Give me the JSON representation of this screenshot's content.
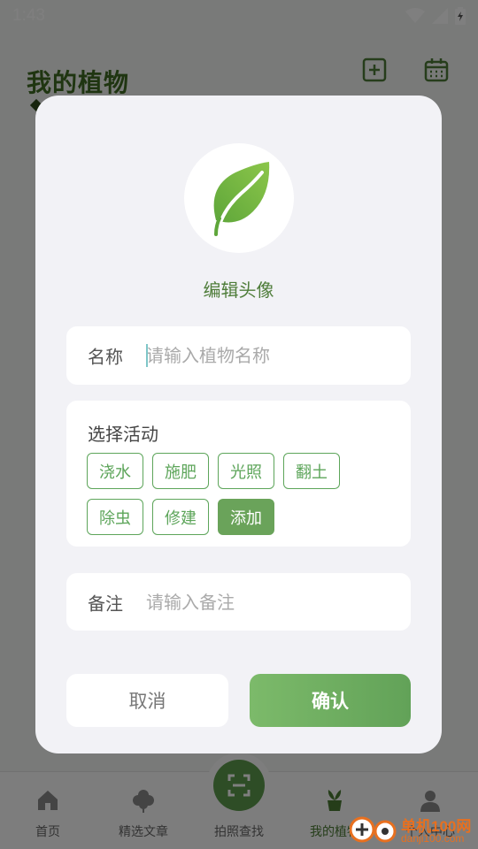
{
  "status_bar": {
    "time": "1:43"
  },
  "header": {
    "title": "我的植物"
  },
  "dialog": {
    "avatar_label": "编辑头像",
    "name": {
      "label": "名称",
      "placeholder": "请输入植物名称",
      "value": ""
    },
    "activity": {
      "title": "选择活动",
      "chips": [
        {
          "label": "浇水",
          "selected": false
        },
        {
          "label": "施肥",
          "selected": false
        },
        {
          "label": "光照",
          "selected": false
        },
        {
          "label": "翻土",
          "selected": false
        },
        {
          "label": "除虫",
          "selected": false
        },
        {
          "label": "修建",
          "selected": false
        },
        {
          "label": "添加",
          "selected": true
        }
      ]
    },
    "note": {
      "label": "备注",
      "placeholder": "请输入备注",
      "value": ""
    },
    "cancel_label": "取消",
    "confirm_label": "确认"
  },
  "bottom_nav": {
    "items": [
      {
        "label": "首页",
        "icon": "home-icon"
      },
      {
        "label": "精选文章",
        "icon": "flower-icon"
      },
      {
        "label": "拍照查找",
        "icon": "scan-icon"
      },
      {
        "label": "我的植物",
        "icon": "potted-plant-icon"
      },
      {
        "label": "个人中心",
        "icon": "person-icon"
      }
    ]
  },
  "watermark": {
    "cn": "单机100网",
    "en": "danji100.com"
  },
  "colors": {
    "primary_green": "#6aa35a",
    "title_green": "#3f6b22",
    "chip_border": "#5da55a",
    "dialog_bg": "#f2f2f6"
  }
}
